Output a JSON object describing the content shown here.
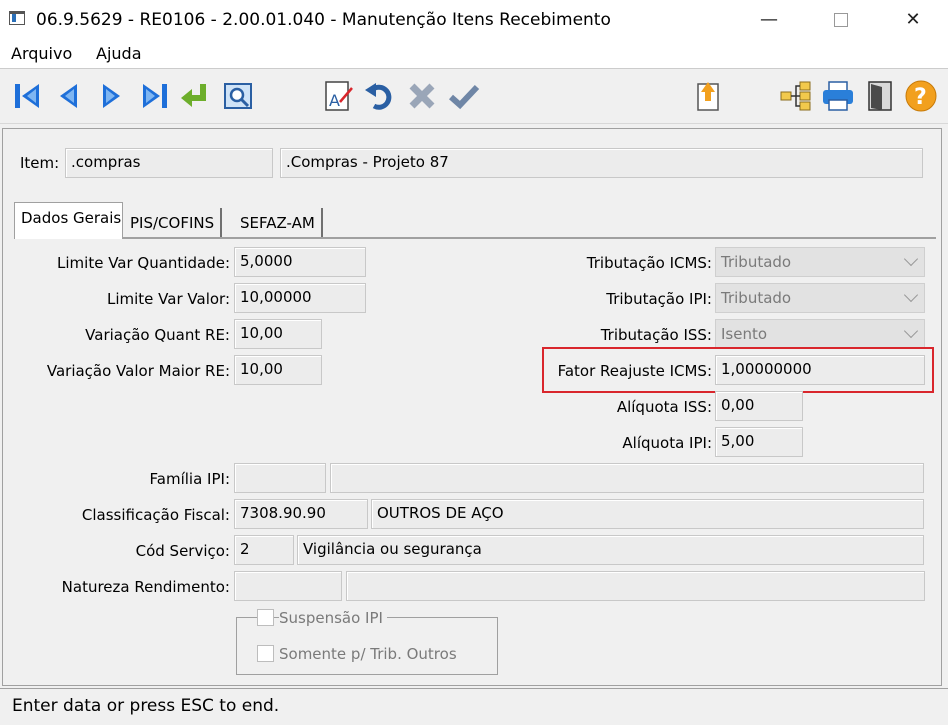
{
  "window": {
    "title": "06.9.5629 - RE0106 - 2.00.01.040 - Manutenção Itens Recebimento"
  },
  "menu": {
    "arquivo": "Arquivo",
    "ajuda": "Ajuda"
  },
  "toolbar": {
    "icons": [
      "first-icon",
      "prev-icon",
      "next-icon",
      "last-icon",
      "goto-icon",
      "search-icon",
      "edit-icon",
      "undo-icon",
      "delete-icon",
      "confirm-icon",
      "export-icon",
      "tree-icon",
      "print-icon",
      "exit-icon",
      "help-icon"
    ]
  },
  "item": {
    "label": "Item:",
    "code": ".compras",
    "description": ".Compras - Projeto 87"
  },
  "tabs": [
    "Dados Gerais",
    "PIS/COFINS",
    "SEFAZ-AM"
  ],
  "form": {
    "limite_var_quantidade": {
      "label": "Limite Var Quantidade:",
      "value": "5,0000"
    },
    "limite_var_valor": {
      "label": "Limite Var Valor:",
      "value": "10,00000"
    },
    "variacao_quant_re": {
      "label": "Variação Quant RE:",
      "value": "10,00"
    },
    "variacao_valor_maior_re": {
      "label": "Variação Valor Maior RE:",
      "value": "10,00"
    },
    "tributacao_icms": {
      "label": "Tributação ICMS:",
      "value": "Tributado"
    },
    "tributacao_ipi": {
      "label": "Tributação IPI:",
      "value": "Tributado"
    },
    "tributacao_iss": {
      "label": "Tributação ISS:",
      "value": "Isento"
    },
    "fator_reajuste_icms": {
      "label": "Fator Reajuste ICMS:",
      "value": "1,00000000"
    },
    "aliquota_iss": {
      "label": "Alíquota ISS:",
      "value": "0,00"
    },
    "aliquota_ipi": {
      "label": "Alíquota IPI:",
      "value": "5,00"
    },
    "familia_ipi": {
      "label": "Família IPI:",
      "code": "",
      "description": ""
    },
    "classificacao_fiscal": {
      "label": "Classificação Fiscal:",
      "code": "7308.90.90",
      "description": "OUTROS DE AÇO"
    },
    "cod_servico": {
      "label": "Cód Serviço:",
      "code": "2",
      "description": "Vigilância ou segurança"
    },
    "natureza_rendimento": {
      "label": "Natureza Rendimento:",
      "code": "",
      "description": ""
    },
    "suspensao_ipi": {
      "label": "Suspensão IPI",
      "checked": false
    },
    "somente_trib_outros": {
      "label": "Somente p/ Trib. Outros",
      "checked": false
    }
  },
  "status": {
    "text": "Enter data or press ESC to end."
  },
  "colors": {
    "highlight": "#d9262c",
    "nav_blue": "#1e6fd9",
    "confirm_green": "#6dae2b"
  }
}
